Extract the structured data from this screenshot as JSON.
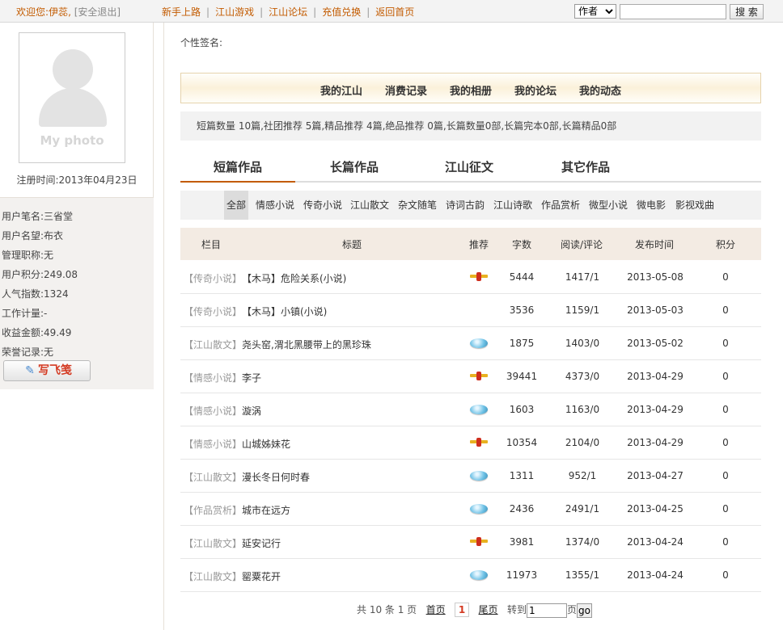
{
  "topbar": {
    "welcome_prefix": "欢迎您:",
    "username": "伊蕊",
    "comma": ",",
    "logout": "[安全退出]",
    "links": [
      "新手上路",
      "江山游戏",
      "江山论坛",
      "充值兑换",
      "返回首页"
    ],
    "search_type": "作者",
    "search_value": "",
    "search_button": "搜 索"
  },
  "sidebar": {
    "photo_placeholder": "My photo",
    "reg_date": "注册时间:2013年04月23日",
    "info": [
      {
        "label": "用户笔名:",
        "value": "三省堂"
      },
      {
        "label": "用户名望:",
        "value": "布衣"
      },
      {
        "label": "管理职称:",
        "value": "无"
      },
      {
        "label": "用户积分:",
        "value": "249.08"
      },
      {
        "label": "人气指数:",
        "value": "1324"
      },
      {
        "label": "工作计量:",
        "value": "-"
      },
      {
        "label": "收益金额:",
        "value": "49.49"
      },
      {
        "label": "荣誉记录:",
        "value": "无"
      }
    ],
    "write_button": "写飞笺"
  },
  "main": {
    "signature_label": "个性签名:",
    "topnav": [
      "我的江山",
      "消费记录",
      "我的相册",
      "我的论坛",
      "我的动态"
    ],
    "stats": "短篇数量 10篇,社团推荐 5篇,精品推荐 4篇,绝品推荐 0篇,长篇数量0部,长篇完本0部,长篇精品0部",
    "tabs": [
      "短篇作品",
      "长篇作品",
      "江山征文",
      "其它作品"
    ],
    "categories": [
      "全部",
      "情感小说",
      "传奇小说",
      "江山散文",
      "杂文随笔",
      "诗词古韵",
      "江山诗歌",
      "作品赏析",
      "微型小说",
      "微电影",
      "影视戏曲"
    ],
    "table": {
      "headers": [
        "栏目",
        "标题",
        "推荐",
        "字数",
        "阅读/评论",
        "发布时间",
        "积分"
      ],
      "rows": [
        {
          "category": "【传奇小说】",
          "title": "【木马】危险关系(小说)",
          "rec": "ribbon",
          "words": "5444",
          "reads": "1417/1",
          "date": "2013-05-08",
          "points": "0"
        },
        {
          "category": "【传奇小说】",
          "title": "【木马】小镇(小说)",
          "rec": "",
          "words": "3536",
          "reads": "1159/1",
          "date": "2013-05-03",
          "points": "0"
        },
        {
          "category": "【江山散文】",
          "title": "尧头窑,渭北黑腰带上的黑珍珠",
          "rec": "gem",
          "words": "1875",
          "reads": "1403/0",
          "date": "2013-05-02",
          "points": "0"
        },
        {
          "category": "【情感小说】",
          "title": "李子",
          "rec": "ribbon",
          "words": "39441",
          "reads": "4373/0",
          "date": "2013-04-29",
          "points": "0"
        },
        {
          "category": "【情感小说】",
          "title": "漩涡",
          "rec": "gem",
          "words": "1603",
          "reads": "1163/0",
          "date": "2013-04-29",
          "points": "0"
        },
        {
          "category": "【情感小说】",
          "title": "山城姊妹花",
          "rec": "ribbon",
          "words": "10354",
          "reads": "2104/0",
          "date": "2013-04-29",
          "points": "0"
        },
        {
          "category": "【江山散文】",
          "title": "漫长冬日何时春",
          "rec": "gem",
          "words": "1311",
          "reads": "952/1",
          "date": "2013-04-27",
          "points": "0"
        },
        {
          "category": "【作品赏析】",
          "title": "城市在远方",
          "rec": "gem",
          "words": "2436",
          "reads": "2491/1",
          "date": "2013-04-25",
          "points": "0"
        },
        {
          "category": "【江山散文】",
          "title": "延安记行",
          "rec": "ribbon",
          "words": "3981",
          "reads": "1374/0",
          "date": "2013-04-24",
          "points": "0"
        },
        {
          "category": "【江山散文】",
          "title": "罂粟花开",
          "rec": "gem",
          "words": "11973",
          "reads": "1355/1",
          "date": "2013-04-24",
          "points": "0"
        }
      ]
    },
    "pager": {
      "summary": "共 10 条 1 页",
      "first": "首页",
      "current": "1",
      "last": "尾页",
      "goto_label": "转到",
      "goto_value": "1",
      "page_unit": "页",
      "go_button": "go"
    }
  }
}
